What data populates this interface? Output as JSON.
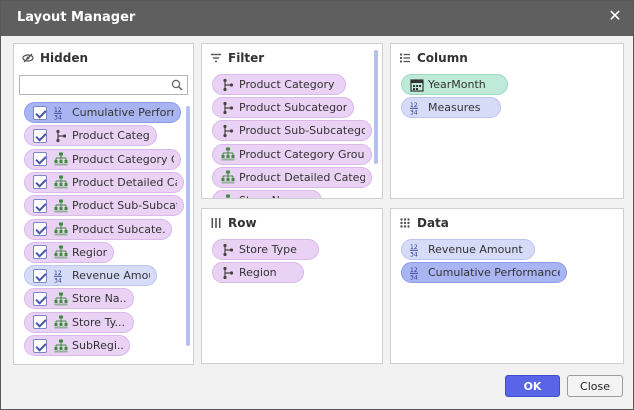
{
  "dialog": {
    "title": "Layout Manager"
  },
  "colors": {
    "dimension": "#ead2f5",
    "measure": "#d6dbf8",
    "measure_selected": "#a9b4f2",
    "time": "#bfe9d9",
    "ok": "#5765e6",
    "titlebar": "#5f5f5f"
  },
  "panels": {
    "hidden": {
      "title": "Hidden",
      "search_placeholder": ""
    },
    "filter": {
      "title": "Filter"
    },
    "column": {
      "title": "Column"
    },
    "row": {
      "title": "Row"
    },
    "data": {
      "title": "Data"
    }
  },
  "hidden_items": [
    {
      "label": "Cumulative Performa...",
      "icon": "measure-icon"
    },
    {
      "label": "Product Catego...",
      "icon": "hierarchy-icon"
    },
    {
      "label": "Product Category G...",
      "icon": "tree-icon"
    },
    {
      "label": "Product Detailed Cate",
      "icon": "tree-icon"
    },
    {
      "label": "Product Sub-Subcate...",
      "icon": "tree-icon"
    },
    {
      "label": "Product Subcate...",
      "icon": "tree-icon"
    },
    {
      "label": "Region",
      "icon": "tree-icon"
    },
    {
      "label": "Revenue Amou...",
      "icon": "measure-icon"
    },
    {
      "label": "Store Na...",
      "icon": "tree-icon"
    },
    {
      "label": "Store Ty...",
      "icon": "tree-icon"
    },
    {
      "label": "SubRegi...",
      "icon": "tree-icon"
    }
  ],
  "filter_items": [
    {
      "label": "Product Category",
      "icon": "hierarchy-icon"
    },
    {
      "label": "Product Subcategory",
      "icon": "hierarchy-icon"
    },
    {
      "label": "Product Sub-Subcategory",
      "icon": "hierarchy-icon"
    },
    {
      "label": "Product Category Group",
      "icon": "tree-icon"
    },
    {
      "label": "Product Detailed Category",
      "icon": "tree-icon"
    },
    {
      "label": "Store Name",
      "icon": "tree-icon"
    }
  ],
  "column_items": [
    {
      "label": "YearMonth",
      "icon": "calendar-icon"
    },
    {
      "label": "Measures",
      "icon": "measure-icon"
    }
  ],
  "row_items": [
    {
      "label": "Store Type",
      "icon": "hierarchy-icon"
    },
    {
      "label": "Region",
      "icon": "hierarchy-icon"
    }
  ],
  "data_items": [
    {
      "label": "Revenue Amount",
      "icon": "measure-icon"
    },
    {
      "label": "Cumulative Performance",
      "icon": "measure-icon"
    }
  ],
  "buttons": {
    "ok": "OK",
    "close": "Close"
  }
}
